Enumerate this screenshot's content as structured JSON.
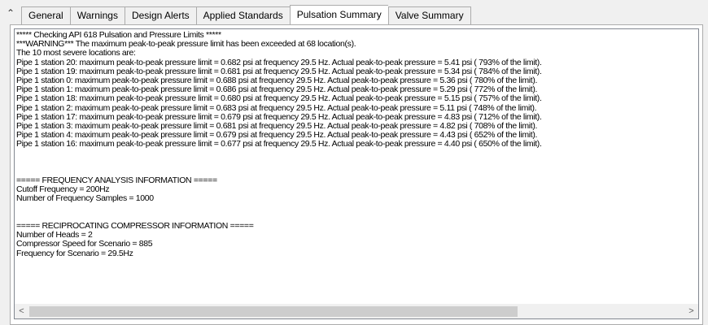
{
  "collapse_icon": "double-chevron-up-icon",
  "collapse_glyph": "»",
  "tabs": [
    {
      "label": "General",
      "active": false
    },
    {
      "label": "Warnings",
      "active": false
    },
    {
      "label": "Design Alerts",
      "active": false
    },
    {
      "label": "Applied Standards",
      "active": false
    },
    {
      "label": "Pulsation Summary",
      "active": true
    },
    {
      "label": "Valve Summary",
      "active": false
    }
  ],
  "report": {
    "lines": [
      "***** Checking API 618 Pulsation and Pressure Limits *****",
      "***WARNING***   The maximum peak-to-peak pressure limit has been exceeded at 68 location(s).",
      "The 10 most severe locations are:",
      "Pipe 1 station 20: maximum peak-to-peak pressure limit = 0.682 psi at frequency 29.5 Hz. Actual peak-to-peak pressure = 5.41 psi ( 793% of the limit).",
      "Pipe 1 station 19: maximum peak-to-peak pressure limit = 0.681 psi at frequency 29.5 Hz. Actual peak-to-peak pressure = 5.34 psi ( 784% of the limit).",
      "Pipe 1 station 0: maximum peak-to-peak pressure limit = 0.688 psi at frequency 29.5 Hz. Actual peak-to-peak pressure = 5.36 psi ( 780% of the limit).",
      "Pipe 1 station 1: maximum peak-to-peak pressure limit = 0.686 psi at frequency 29.5 Hz. Actual peak-to-peak pressure = 5.29 psi ( 772% of the limit).",
      "Pipe 1 station 18: maximum peak-to-peak pressure limit = 0.680 psi at frequency 29.5 Hz. Actual peak-to-peak pressure = 5.15 psi ( 757% of the limit).",
      "Pipe 1 station 2: maximum peak-to-peak pressure limit = 0.683 psi at frequency 29.5 Hz. Actual peak-to-peak pressure = 5.11 psi ( 748% of the limit).",
      "Pipe 1 station 17: maximum peak-to-peak pressure limit = 0.679 psi at frequency 29.5 Hz. Actual peak-to-peak pressure = 4.83 psi ( 712% of the limit).",
      "Pipe 1 station 3: maximum peak-to-peak pressure limit = 0.681 psi at frequency 29.5 Hz. Actual peak-to-peak pressure = 4.82 psi ( 708% of the limit).",
      "Pipe 1 station 4: maximum peak-to-peak pressure limit = 0.679 psi at frequency 29.5 Hz. Actual peak-to-peak pressure = 4.43 psi ( 652% of the limit).",
      "Pipe 1 station 16: maximum peak-to-peak pressure limit = 0.677 psi at frequency 29.5 Hz. Actual peak-to-peak pressure = 4.40 psi ( 650% of the limit).",
      "",
      "",
      "",
      "===== FREQUENCY ANALYSIS INFORMATION =====",
      "Cutoff Frequency = 200Hz",
      "Number of Frequency Samples = 1000",
      "",
      "",
      "===== RECIPROCATING COMPRESSOR INFORMATION =====",
      "Number of Heads = 2",
      "Compressor Speed for Scenario = 885",
      "Frequency for Scenario = 29.5Hz"
    ]
  },
  "scrollbar": {
    "left_icon": "chevron-left-icon",
    "left_glyph": "<",
    "right_icon": "chevron-right-icon",
    "right_glyph": ">"
  }
}
